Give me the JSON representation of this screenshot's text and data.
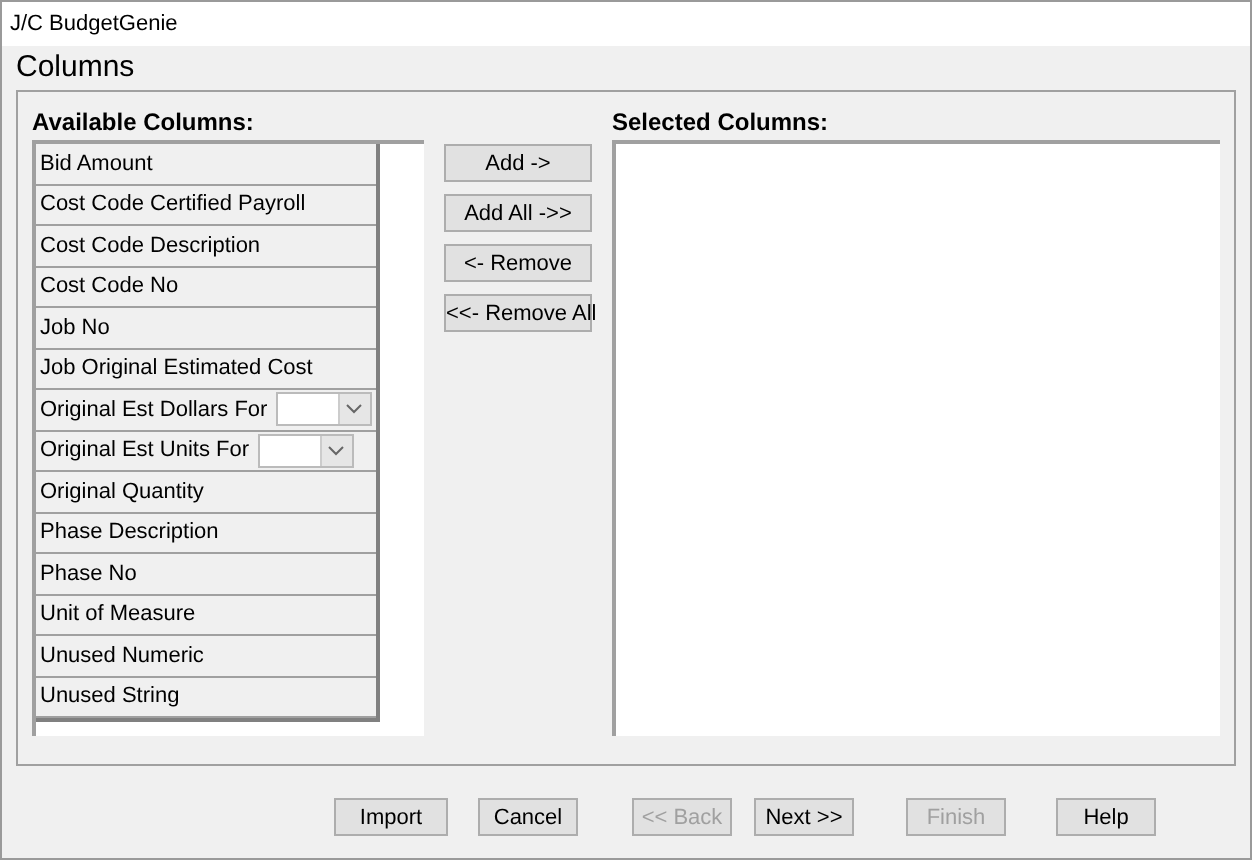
{
  "window": {
    "title": "J/C BudgetGenie"
  },
  "heading": "Columns",
  "available": {
    "label": "Available Columns:",
    "items": [
      {
        "label": "Bid Amount",
        "kind": "plain"
      },
      {
        "label": "Cost Code Certified Payroll",
        "kind": "plain"
      },
      {
        "label": "Cost Code Description",
        "kind": "plain"
      },
      {
        "label": "Cost Code No",
        "kind": "plain"
      },
      {
        "label": "Job No",
        "kind": "plain"
      },
      {
        "label": "Job Original Estimated Cost",
        "kind": "plain"
      },
      {
        "label": "Original Est Dollars For",
        "kind": "dropdown"
      },
      {
        "label": "Original Est Units For",
        "kind": "dropdown"
      },
      {
        "label": "Original Quantity",
        "kind": "plain"
      },
      {
        "label": "Phase Description",
        "kind": "plain"
      },
      {
        "label": "Phase No",
        "kind": "plain"
      },
      {
        "label": "Unit of Measure",
        "kind": "plain"
      },
      {
        "label": "Unused Numeric",
        "kind": "plain"
      },
      {
        "label": "Unused String",
        "kind": "plain"
      }
    ]
  },
  "transfer_buttons": [
    "Add ->",
    "Add All ->>",
    "<- Remove",
    "<<- Remove All"
  ],
  "selected": {
    "label": "Selected Columns:"
  },
  "footer_buttons": [
    {
      "label": "Import",
      "disabled": false
    },
    {
      "label": "Cancel",
      "disabled": false
    },
    {
      "label": "<< Back",
      "disabled": true
    },
    {
      "label": "Next >>",
      "disabled": false
    },
    {
      "label": "Finish",
      "disabled": true
    },
    {
      "label": "Help",
      "disabled": false
    }
  ]
}
